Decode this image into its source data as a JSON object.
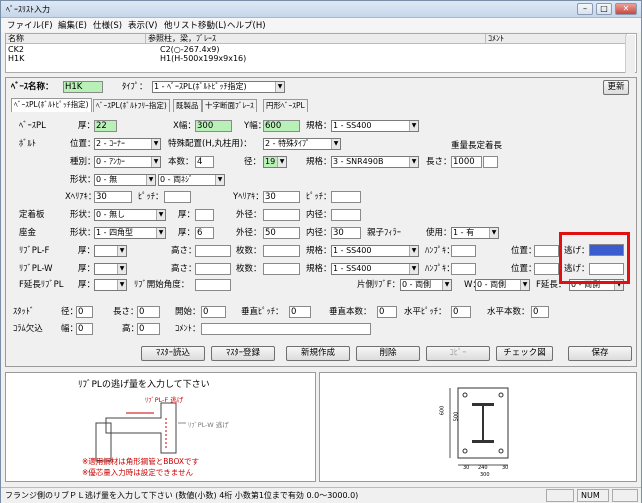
{
  "window": {
    "title": "ﾍﾞｰｽﾘｽﾄ入力",
    "min": "–",
    "max": "□",
    "close": "✕"
  },
  "menu": [
    "ファイル(F)",
    "編集(E)",
    "仕様(S)",
    "表示(V)",
    "他リスト移動(L)",
    "ヘルプ(H)"
  ],
  "list": {
    "headers": [
      "名称",
      "参照柱，梁，ﾌﾞﾚｰｽ",
      "ｺﾒﾝﾄ"
    ],
    "rows": [
      [
        "CK2",
        "C2(○-267.4x9)",
        ""
      ],
      [
        "H1K",
        "H1(H-500x199x9x16)",
        ""
      ]
    ]
  },
  "top": {
    "base_name_label": "ﾍﾞｰｽ名称：",
    "base_name": "H1K",
    "type_label": "ﾀｲﾌﾟ：",
    "type_value": "1 - ﾍﾞｰｽPL(ﾎﾞﾙﾄﾋﾟｯﾁ指定)",
    "update": "更新"
  },
  "tabs": [
    "ﾍﾞｰｽPL(ﾎﾞﾙﾄﾋﾟｯﾁ指定)",
    "ﾍﾞｰｽPL(ﾎﾞﾙﾄﾌﾘｰ指定)",
    "既製品",
    "十字断面ﾌﾞﾚｰｽ",
    "円形ﾍﾞｰｽPL"
  ],
  "form": {
    "basepl": {
      "label": "ﾍﾞｰｽPL",
      "thick_label": "厚：",
      "thick": "22",
      "xw_label": "X幅：",
      "xw": "300",
      "yw_label": "Y幅：",
      "yw": "600",
      "spec_label": "規格：",
      "spec": "1 - SS400"
    },
    "bolt": {
      "label": "ﾎﾞﾙﾄ",
      "pos_label": "位置：",
      "pos": "2 - ｺｰﾅｰ",
      "special_label": "特殊配置(H,丸柱用)：",
      "special": "2 - 特殊ﾀｲﾌﾟ",
      "kind_label": "種別：",
      "kind": "0 - ｱﾝｶｰ",
      "count_label": "本数：",
      "count": "4",
      "dia_label": "径：",
      "dia": "19",
      "bspec_label": "規格：",
      "bspec": "3 - SNR490B",
      "len_label": "長さ：",
      "len": "1000",
      "heavy_label": "重量長定着長",
      "shape_label": "形状：",
      "shape": "0 - 無",
      "shape2": "0 - 両ﾈｼﾞ",
      "xh_label": "Xﾍﾘｱｷ：",
      "xh": "30",
      "xp_label": "ﾋﾟｯﾁ：",
      "xp": "",
      "yh_label": "Yﾍﾘｱｷ：",
      "yh": "30",
      "yp_label": "ﾋﾟｯﾁ：",
      "yp": ""
    },
    "anchor": {
      "label": "定着板",
      "shape_label": "形状：",
      "shape": "0 - 無し",
      "thick_label": "厚：",
      "thick": "",
      "od_label": "外径：",
      "od": "",
      "id_label": "内径：",
      "id": ""
    },
    "seat": {
      "label": "座金",
      "shape_label": "形状：",
      "shape": "1 - 四角型",
      "thick_label": "厚：",
      "thick": "6",
      "od_label": "外径：",
      "od": "50",
      "id_label": "内径：",
      "id": "30",
      "filler_label": "親子ﾌｨﾗｰ",
      "use_label": "使用：",
      "use": "1 - 有"
    },
    "ribf": {
      "label": "ﾘﾌﾞPL-F",
      "thick_label": "厚：",
      "thick": "",
      "h_label": "高さ：",
      "h": "",
      "cnt_label": "枚数：",
      "cnt": "",
      "spec_label": "規格：",
      "spec": "1 - SS400",
      "hc_label": "ﾊﾝﾌﾟｷ：",
      "hc": "",
      "pos_label": "位置：",
      "pos": "",
      "esc_label": "逃げ：",
      "esc": ""
    },
    "ribw": {
      "label": "ﾘﾌﾞPL-W",
      "thick_label": "厚：",
      "thick": "",
      "h_label": "高さ：",
      "h": "",
      "cnt_label": "枚数：",
      "cnt": "",
      "spec_label": "規格：",
      "spec": "1 - SS400",
      "hc_label": "ﾊﾝﾌﾟｷ：",
      "hc": "",
      "pos_label": "位置：",
      "pos": "",
      "esc_label": "逃げ：",
      "esc": ""
    },
    "fext": {
      "label": "F延長ﾘﾌﾞPL",
      "thick_label": "厚：",
      "thick": "",
      "angle_label": "ﾘﾌﾞ開始角度：",
      "angle": "",
      "side_label": "片側ﾘﾌﾞF：",
      "side": "0 - 両側",
      "w_label": "W：",
      "w": "0 - 両側",
      "fext_label": "F延長：",
      "fext": "0 - 両側"
    },
    "stud": {
      "label": "ｽﾀｯﾄﾞ",
      "dia_label": "径：",
      "dia": "0",
      "len_label": "長さ：",
      "len": "0",
      "start_label": "開始：",
      "start": "0",
      "vp_label": "垂直ﾋﾟｯﾁ：",
      "vp": "0",
      "vn_label": "垂直本数：",
      "vn": "0",
      "hp_label": "水平ﾋﾟｯﾁ：",
      "hp": "0",
      "hn_label": "水平本数：",
      "hn": "0"
    },
    "notch": {
      "label": "ｺﾗﾑ欠込",
      "w_label": "幅：",
      "w": "0",
      "h_label": "高：",
      "h": "0",
      "cm_label": "ｺﾒﾝﾄ：",
      "cm": ""
    }
  },
  "buttons": [
    "ﾏｽﾀｰ読込",
    "ﾏｽﾀｰ登録",
    "新規作成",
    "削除",
    "ｺﾋﾟｰ",
    "チェック図",
    "保存"
  ],
  "left_pane": {
    "title": "ﾘﾌﾞPLの逃げ量を入力して下さい",
    "rib_f": "ﾘﾌﾞPL-F 逃げ",
    "rib_w": "ﾘﾌﾞPL-W 逃げ",
    "note1": "※適用鋼材は角形鋼管とBBOXです",
    "note2": "※優芯量入力時は設定できません"
  },
  "right_pane": {
    "d1": "600",
    "d2": "500",
    "d3": "300",
    "d4": "30",
    "d5": "240",
    "d6": "30"
  },
  "status": {
    "msg": "フランジ側のリブＰＬ逃げ量を入力して下さい (数値(小数) 4桁 小数第1位まで有効 0.0〜3000.0)",
    "num": "NUM"
  },
  "colors": {
    "highlight": "#e01010",
    "input_green": "#b8f0b8",
    "selected_blue": "#3a5ccf"
  }
}
